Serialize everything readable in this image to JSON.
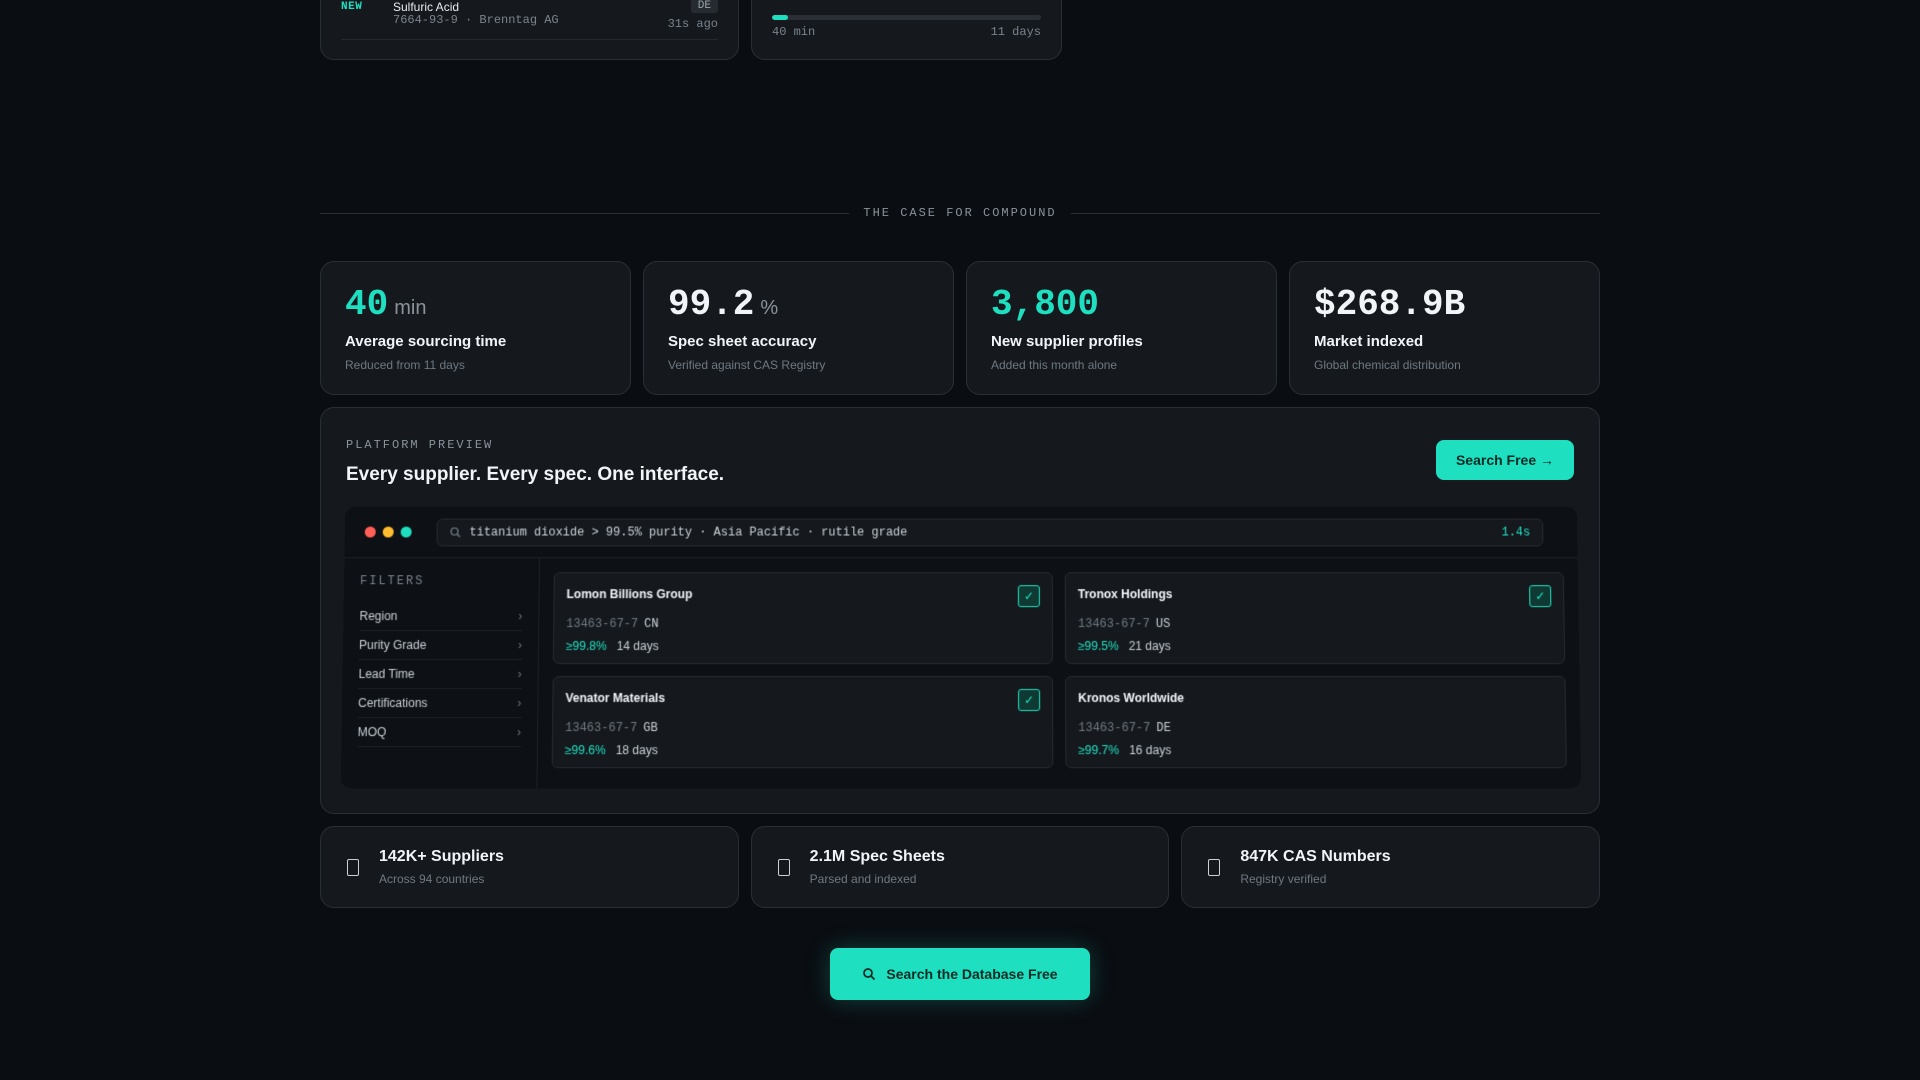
{
  "ticker": {
    "badge": "NEW",
    "compound_name": "Sulfuric Acid",
    "compound_meta": "7664-93-9 · Brenntag AG",
    "country": "DE",
    "ago": "31s ago"
  },
  "progress": {
    "fraction": 0.06,
    "left_label": "40 min",
    "right_label": "11 days"
  },
  "section_label": "THE CASE FOR COMPOUND",
  "stats": [
    {
      "value": "40",
      "unit": "min",
      "title": "Average sourcing time",
      "sub": "Reduced from 11 days",
      "color": "#1ee0c0"
    },
    {
      "value": "99.2",
      "unit": "%",
      "title": "Spec sheet accuracy",
      "sub": "Verified against CAS Registry",
      "color": "#f2f5f7"
    },
    {
      "value": "3,800",
      "unit": "",
      "title": "New supplier profiles",
      "sub": "Added this month alone",
      "color": "#1ee0c0"
    },
    {
      "value": "$268.9B",
      "unit": "",
      "title": "Market indexed",
      "sub": "Global chemical distribution",
      "color": "#f2f5f7"
    }
  ],
  "preview": {
    "kicker": "PLATFORM PREVIEW",
    "headline": "Every supplier. Every spec. One interface.",
    "button": "Search Free →",
    "query": "titanium dioxide > 99.5% purity · Asia Pacific · rutile grade",
    "query_time": "1.4s",
    "filters_title": "FILTERS",
    "filters": [
      "Region",
      "Purity Grade",
      "Lead Time",
      "Certifications",
      "MOQ"
    ],
    "results": [
      {
        "name": "Lomon Billions Group",
        "cas": "13463-67-7",
        "country": "CN",
        "purity": "≥99.8%",
        "lead": "14 days",
        "verified": true
      },
      {
        "name": "Tronox Holdings",
        "cas": "13463-67-7",
        "country": "US",
        "purity": "≥99.5%",
        "lead": "21 days",
        "verified": true
      },
      {
        "name": "Venator Materials",
        "cas": "13463-67-7",
        "country": "GB",
        "purity": "≥99.6%",
        "lead": "18 days",
        "verified": true
      },
      {
        "name": "Kronos Worldwide",
        "cas": "13463-67-7",
        "country": "DE",
        "purity": "≥99.7%",
        "lead": "16 days",
        "verified": false
      }
    ]
  },
  "features": [
    {
      "title": "142K+ Suppliers",
      "sub": "Across 94 countries",
      "icon": "document-icon"
    },
    {
      "title": "2.1M Spec Sheets",
      "sub": "Parsed and indexed",
      "icon": "document-icon"
    },
    {
      "title": "847K CAS Numbers",
      "sub": "Registry verified",
      "icon": "document-icon"
    }
  ],
  "cta": "Search the Database Free",
  "colors": {
    "accent": "#1ee0c0",
    "background": "#0a0d12",
    "dot_red": "#ff5f57",
    "dot_yellow": "#febc2e",
    "dot_green": "#1ee0c0"
  }
}
